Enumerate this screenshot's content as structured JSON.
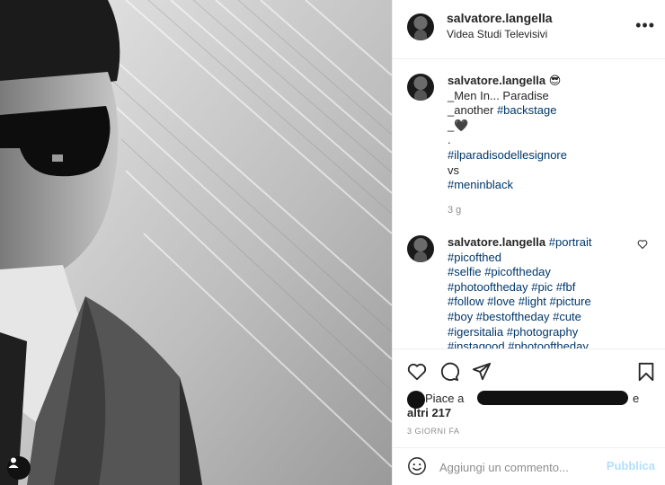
{
  "header": {
    "username": "salvatore.langella",
    "location": "Videa Studi Televisivi",
    "more_label": "•••"
  },
  "caption": {
    "username": "salvatore.langella",
    "emoji": "😎",
    "lines": [
      "_Men In... Paradise",
      "_another ",
      "_🖤",
      "."
    ],
    "backstage_tag": "#backstage",
    "tag1": "#ilparadisodellesignore",
    "vs": "vs",
    "tag2": "#meninblack",
    "time": "3 g"
  },
  "comment": {
    "username": "salvatore.langella",
    "lines": [
      "#portrait",
      "#picofthed",
      "#selfie #picoftheday",
      "#photooftheday #pic #fbf",
      "#follow #love #light #picture",
      "#boy #bestoftheday #cute",
      "#igersitalia #photography",
      "#instagood #photooftheday"
    ]
  },
  "likes": {
    "prefix": "Piace a",
    "suffix": "e",
    "others": "altri 217"
  },
  "date": "3 GIORNI FA",
  "add_comment": {
    "placeholder": "Aggiungi un commento...",
    "publish": "Pubblica"
  },
  "colors": {
    "hashtag": "#00376b",
    "publish_disabled": "#b2dffc",
    "muted": "#8e8e8e"
  }
}
